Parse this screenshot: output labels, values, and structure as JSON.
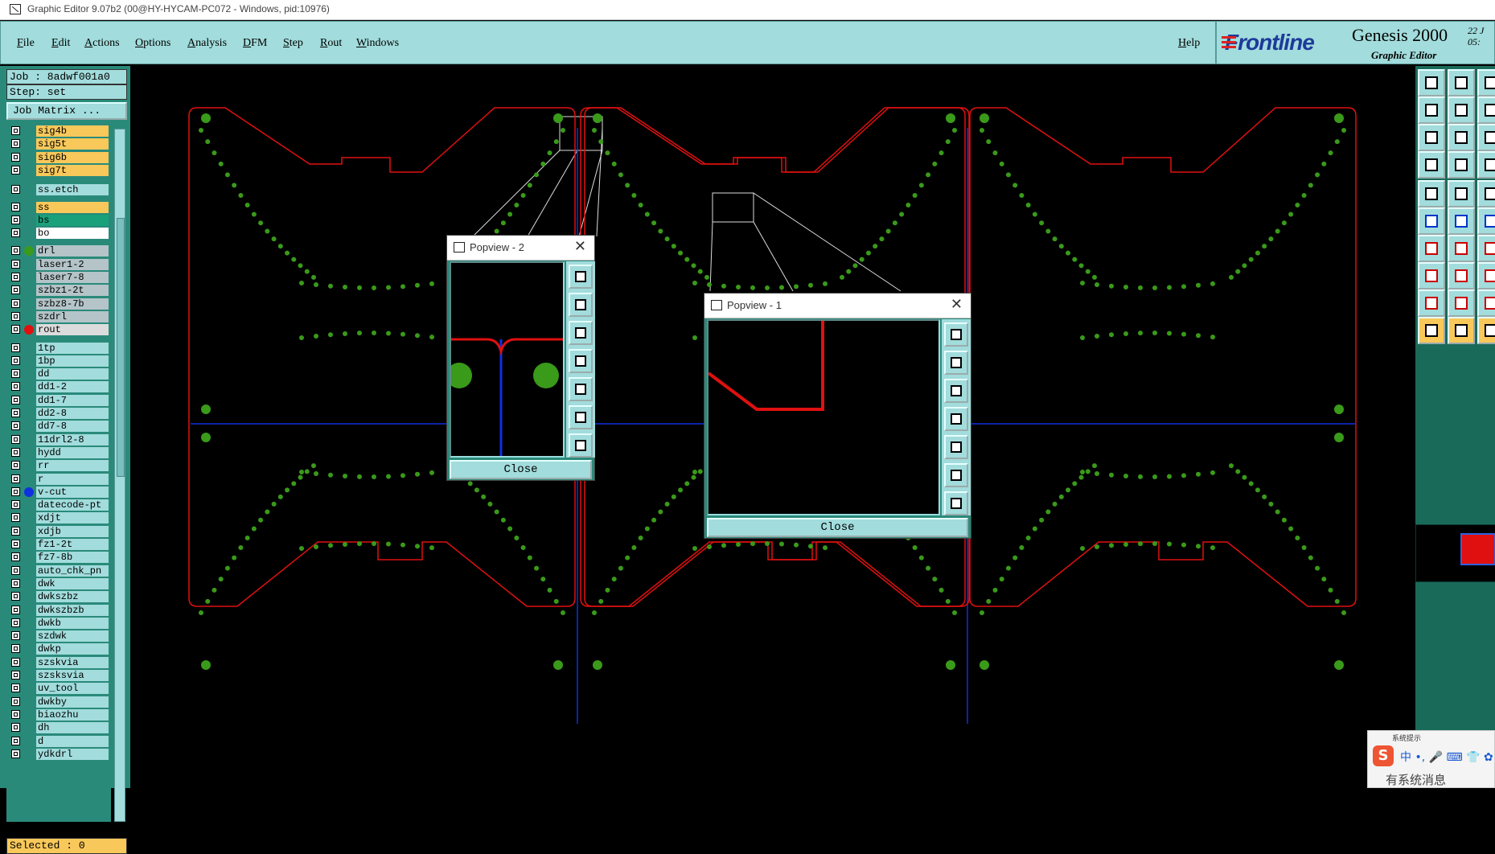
{
  "window": {
    "title": "Graphic Editor 9.07b2 (00@HY-HYCAM-PC072 - Windows, pid:10976)"
  },
  "menu": {
    "items": [
      "File",
      "Edit",
      "Actions",
      "Options",
      "Analysis",
      "DFM",
      "Step",
      "Rout",
      "Windows"
    ],
    "help": "Help"
  },
  "brand": {
    "logo": "Frontline",
    "product": "Genesis 2000",
    "subtitle": "Graphic Editor",
    "date_line1": "22 J",
    "date_line2": "05:"
  },
  "job": {
    "job_label": "Job : 8adwf001a0",
    "step_label": "Step: set",
    "job_matrix": "Job Matrix ..."
  },
  "layers": [
    {
      "name": "sig4b",
      "color": "#f8c85a"
    },
    {
      "name": "sig5t",
      "color": "#f8c85a"
    },
    {
      "name": "sig6b",
      "color": "#f8c85a"
    },
    {
      "name": "sig7t",
      "color": "#f8c85a"
    },
    {
      "name": "ss.etch",
      "color": "#a2dcdc"
    },
    {
      "name": "ss",
      "color": "#f8c85a"
    },
    {
      "name": "bs",
      "color": "#1aa07a"
    },
    {
      "name": "bo",
      "color": "#ffffff"
    },
    {
      "name": "drl",
      "color": "#b4c4c8",
      "dot": "#3a9a1a"
    },
    {
      "name": "laser1-2",
      "color": "#b4c4c8"
    },
    {
      "name": "laser7-8",
      "color": "#b4c4c8"
    },
    {
      "name": "szbz1-2t",
      "color": "#b4c4c8"
    },
    {
      "name": "szbz8-7b",
      "color": "#b4c4c8"
    },
    {
      "name": "szdrl",
      "color": "#b4c4c8"
    },
    {
      "name": "rout",
      "color": "#dcdcdc",
      "dot": "#e01010"
    },
    {
      "name": "1tp",
      "color": "#a2dcdc"
    },
    {
      "name": "1bp",
      "color": "#a2dcdc"
    },
    {
      "name": "dd",
      "color": "#a2dcdc"
    },
    {
      "name": "dd1-2",
      "color": "#a2dcdc"
    },
    {
      "name": "dd1-7",
      "color": "#a2dcdc"
    },
    {
      "name": "dd2-8",
      "color": "#a2dcdc"
    },
    {
      "name": "dd7-8",
      "color": "#a2dcdc"
    },
    {
      "name": "11drl2-8",
      "color": "#a2dcdc"
    },
    {
      "name": "hydd",
      "color": "#a2dcdc"
    },
    {
      "name": "rr",
      "color": "#a2dcdc"
    },
    {
      "name": "r",
      "color": "#a2dcdc"
    },
    {
      "name": "v-cut",
      "color": "#a2dcdc",
      "dot": "#1030e0"
    },
    {
      "name": "datecode-pt",
      "color": "#a2dcdc"
    },
    {
      "name": "xdjt",
      "color": "#a2dcdc"
    },
    {
      "name": "xdjb",
      "color": "#a2dcdc"
    },
    {
      "name": "fz1-2t",
      "color": "#a2dcdc"
    },
    {
      "name": "fz7-8b",
      "color": "#a2dcdc"
    },
    {
      "name": "auto_chk_pn",
      "color": "#a2dcdc"
    },
    {
      "name": "dwk",
      "color": "#a2dcdc"
    },
    {
      "name": "dwkszbz",
      "color": "#a2dcdc"
    },
    {
      "name": "dwkszbzb",
      "color": "#a2dcdc"
    },
    {
      "name": "dwkb",
      "color": "#a2dcdc"
    },
    {
      "name": "szdwk",
      "color": "#a2dcdc"
    },
    {
      "name": "dwkp",
      "color": "#a2dcdc"
    },
    {
      "name": "szskvia",
      "color": "#a2dcdc"
    },
    {
      "name": "szsksvia",
      "color": "#a2dcdc"
    },
    {
      "name": "uv_tool",
      "color": "#a2dcdc"
    },
    {
      "name": "dwkby",
      "color": "#a2dcdc"
    },
    {
      "name": "biaozhu",
      "color": "#a2dcdc"
    },
    {
      "name": "dh",
      "color": "#a2dcdc"
    },
    {
      "name": "d",
      "color": "#a2dcdc"
    },
    {
      "name": "ydkdrl",
      "color": "#a2dcdc"
    }
  ],
  "status": {
    "selected": "Selected : 0"
  },
  "popview2": {
    "title": "Popview - 2",
    "close": "Close"
  },
  "popview1": {
    "title": "Popview - 1",
    "close": "Close"
  },
  "tray": {
    "notice": "系统提示",
    "ime_logo": "S",
    "ime_bar": "中 •, 🎤 ⌨ 👕 ✿",
    "message": "有系统消息"
  },
  "colors": {
    "panel": "#a2dcdc",
    "rout": "#e01010",
    "vcut": "#1030e0",
    "drill": "#3a9a1a"
  }
}
